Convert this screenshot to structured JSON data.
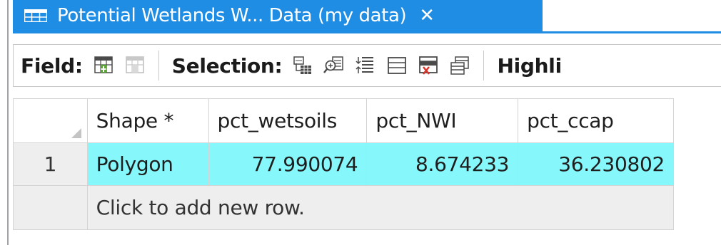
{
  "tab": {
    "title": "Potential Wetlands W... Data (my data)",
    "close_glyph": "✕",
    "icon": "table-icon",
    "color": "#1f8de4"
  },
  "toolbar": {
    "field_label": "Field:",
    "selection_label": "Selection:",
    "highlight_label": "Highli",
    "field_icons": [
      "add-field-icon",
      "calculate-field-icon"
    ],
    "selection_icons": [
      "select-by-attributes-icon",
      "zoom-to-selection-icon",
      "switch-selection-icon",
      "clear-selection-icon",
      "delete-selection-icon",
      "copy-selection-icon"
    ]
  },
  "grid": {
    "columns": [
      "Shape *",
      "pct_wetsoils",
      "pct_NWI",
      "pct_ccap"
    ],
    "rows": [
      {
        "num": "1",
        "cells": [
          "Polygon",
          "77.990074",
          "8.674233",
          "36.230802"
        ]
      }
    ],
    "new_row_text": "Click to add new row.",
    "selected_color": "#86f7fb"
  }
}
